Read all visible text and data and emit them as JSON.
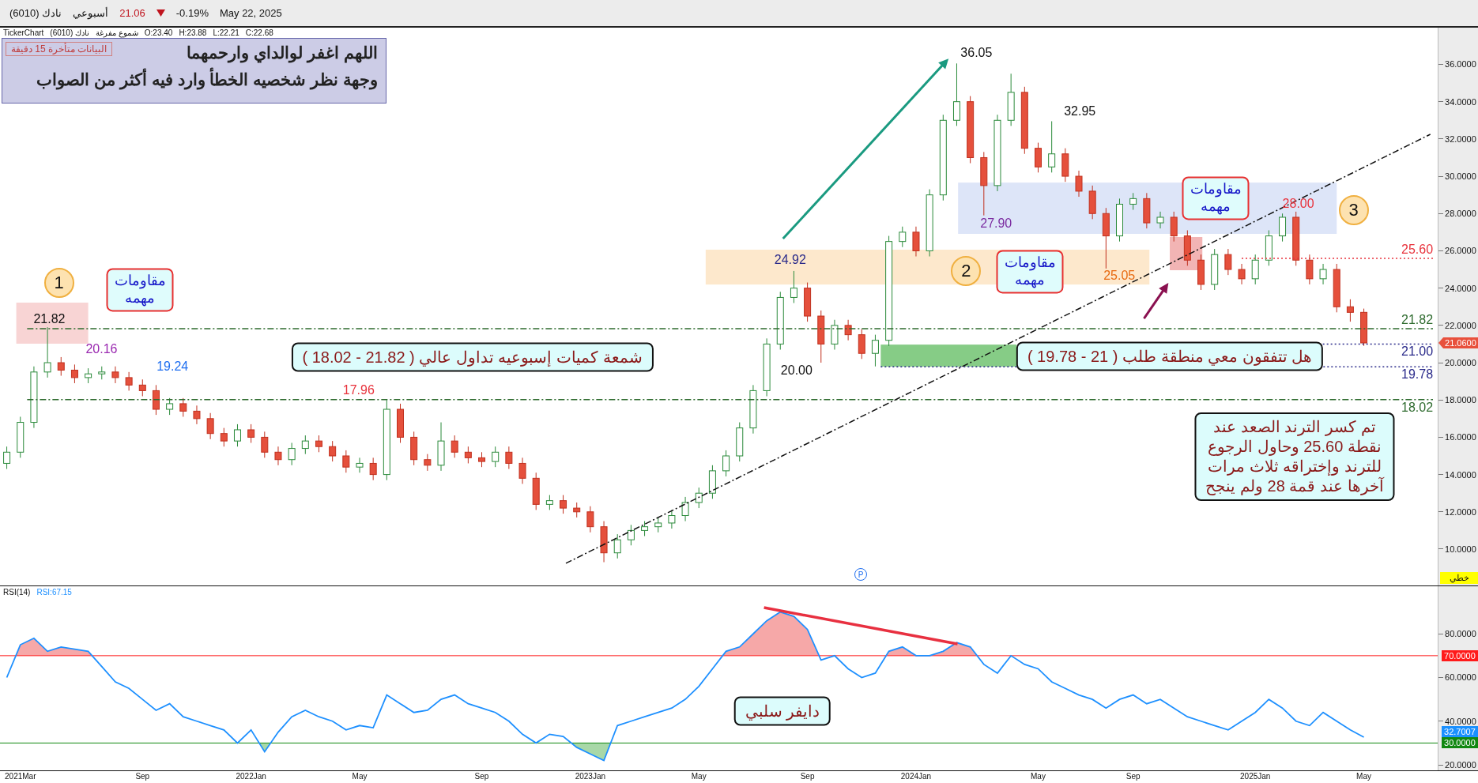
{
  "header": {
    "symbol": "نادك (6010)",
    "interval": "أسبوعي",
    "price": "21.06",
    "down": true,
    "change": "-0.19%",
    "date": "May 22, 2025"
  },
  "legend": {
    "source": "TickerChart",
    "symbol": "نادك (6010)",
    "chart_style": "شموع مفرغة",
    "ohlc": [
      "O:23.40",
      "H:23.88",
      "L:22.21",
      "C:22.68"
    ]
  },
  "info_box": {
    "delay_badge": "البيانات متأخرة 15 دقيقة",
    "lines": [
      "اللهم اغفر لوالداي وارحمهما",
      "وجهة نظر شخصيه الخطأ وارد فيه أكثر من الصواب"
    ]
  },
  "price_chart": {
    "price_tag": "21.0600",
    "scale_mode": "خطي",
    "marker": "P",
    "chart_data": {
      "type": "candlestick",
      "ylim": [
        8.05,
        37.97
      ],
      "ref_lines": [
        {
          "axis": "y",
          "value": 25.6,
          "label": "25.60",
          "color": "#e8323c"
        },
        {
          "axis": "y",
          "value": 21.82,
          "label": "21.82",
          "color": "#2e6b2e"
        },
        {
          "axis": "y",
          "value": 21.0,
          "label": "21.00",
          "color": "#2a2a8a"
        },
        {
          "axis": "y",
          "value": 19.78,
          "label": "19.78",
          "color": "#2a2a8a"
        },
        {
          "axis": "y",
          "value": 18.02,
          "label": "18.02",
          "color": "#2e6b2e"
        }
      ],
      "yticks": [
        {
          "value": 10,
          "label": "10.0000"
        },
        {
          "value": 12,
          "label": "12.0000"
        },
        {
          "value": 14,
          "label": "14.0000"
        },
        {
          "value": 16,
          "label": "16.0000"
        },
        {
          "value": 18,
          "label": "18.0000"
        },
        {
          "value": 20,
          "label": "20.0000"
        },
        {
          "value": 22,
          "label": "22.0000"
        },
        {
          "value": 24,
          "label": "24.0000"
        },
        {
          "value": 26,
          "label": "26.0000"
        },
        {
          "value": 28,
          "label": "28.0000"
        },
        {
          "value": 30,
          "label": "30.0000"
        },
        {
          "value": 32,
          "label": "32.0000"
        },
        {
          "value": 34,
          "label": "34.0000"
        },
        {
          "value": 36,
          "label": "36.0000"
        }
      ],
      "categories": [
        null,
        null,
        null,
        null,
        null,
        null,
        null,
        null,
        null,
        null,
        null,
        null,
        null,
        null,
        null,
        null,
        null,
        null,
        null,
        null,
        null,
        null,
        null,
        null,
        null,
        null,
        null,
        null,
        null,
        null,
        null,
        null,
        null,
        null,
        null,
        null,
        null,
        null,
        null,
        null,
        null,
        null,
        null,
        null,
        null,
        null,
        null,
        null,
        null,
        null,
        null,
        null,
        null,
        null,
        null,
        null,
        null,
        null,
        null,
        null,
        null,
        null,
        null,
        null,
        null,
        null,
        null,
        null,
        null,
        null,
        null,
        null,
        null,
        null,
        null,
        null,
        null,
        null,
        null,
        null,
        null,
        null,
        null,
        null,
        null,
        null,
        null,
        null,
        null,
        null,
        null,
        null,
        null,
        null,
        null,
        null,
        null,
        null,
        null,
        null,
        null,
        null,
        null,
        null,
        null,
        null
      ],
      "ohlc": [
        [
          14.6,
          15.5,
          14.3,
          15.2
        ],
        [
          15.2,
          17.1,
          14.9,
          16.8
        ],
        [
          16.8,
          19.8,
          16.5,
          19.5
        ],
        [
          19.5,
          21.9,
          19.2,
          20.0
        ],
        [
          20.0,
          20.3,
          19.3,
          19.6
        ],
        [
          19.6,
          19.9,
          18.9,
          19.2
        ],
        [
          19.2,
          19.7,
          18.9,
          19.4
        ],
        [
          19.4,
          19.8,
          19.1,
          19.5
        ],
        [
          19.5,
          19.8,
          18.9,
          19.2
        ],
        [
          19.2,
          19.5,
          18.5,
          18.8
        ],
        [
          18.8,
          19.1,
          18.2,
          18.5
        ],
        [
          18.5,
          18.8,
          17.2,
          17.5
        ],
        [
          17.5,
          18.1,
          17.2,
          17.8
        ],
        [
          17.8,
          18.1,
          17.1,
          17.4
        ],
        [
          17.4,
          17.7,
          16.7,
          17.0
        ],
        [
          17.0,
          17.3,
          15.9,
          16.2
        ],
        [
          16.2,
          16.5,
          15.5,
          15.8
        ],
        [
          15.8,
          16.7,
          15.5,
          16.4
        ],
        [
          16.4,
          16.7,
          15.7,
          16.0
        ],
        [
          16.0,
          16.3,
          14.9,
          15.2
        ],
        [
          15.2,
          15.5,
          14.5,
          14.8
        ],
        [
          14.8,
          15.7,
          14.5,
          15.4
        ],
        [
          15.4,
          16.1,
          15.1,
          15.8
        ],
        [
          15.8,
          16.1,
          15.2,
          15.5
        ],
        [
          15.5,
          15.8,
          14.7,
          15.0
        ],
        [
          15.0,
          15.3,
          14.1,
          14.4
        ],
        [
          14.4,
          14.9,
          14.1,
          14.6
        ],
        [
          14.6,
          14.9,
          13.7,
          14.0
        ],
        [
          14.0,
          18.0,
          13.7,
          17.5
        ],
        [
          17.5,
          17.8,
          15.7,
          16.0
        ],
        [
          16.0,
          16.3,
          14.5,
          14.8
        ],
        [
          14.8,
          15.1,
          14.2,
          14.5
        ],
        [
          14.5,
          16.8,
          14.2,
          15.8
        ],
        [
          15.8,
          16.1,
          14.9,
          15.2
        ],
        [
          15.2,
          15.5,
          14.6,
          14.9
        ],
        [
          14.9,
          15.2,
          14.4,
          14.7
        ],
        [
          14.7,
          15.5,
          14.4,
          15.2
        ],
        [
          15.2,
          15.5,
          14.3,
          14.6
        ],
        [
          14.6,
          14.9,
          13.5,
          13.8
        ],
        [
          13.8,
          14.1,
          12.1,
          12.4
        ],
        [
          12.4,
          12.9,
          12.1,
          12.6
        ],
        [
          12.6,
          12.9,
          11.9,
          12.2
        ],
        [
          12.2,
          12.5,
          11.7,
          12.0
        ],
        [
          12.0,
          12.3,
          10.9,
          11.2
        ],
        [
          11.2,
          11.5,
          9.3,
          9.8
        ],
        [
          9.8,
          10.8,
          9.5,
          10.5
        ],
        [
          10.5,
          11.3,
          10.2,
          11.0
        ],
        [
          11.0,
          11.5,
          10.7,
          11.2
        ],
        [
          11.2,
          11.7,
          10.9,
          11.4
        ],
        [
          11.4,
          12.1,
          11.1,
          11.8
        ],
        [
          11.8,
          12.8,
          11.5,
          12.5
        ],
        [
          12.5,
          13.3,
          12.2,
          13.0
        ],
        [
          13.0,
          14.5,
          12.7,
          14.2
        ],
        [
          14.2,
          15.3,
          13.9,
          15.0
        ],
        [
          15.0,
          16.8,
          14.7,
          16.5
        ],
        [
          16.5,
          18.8,
          16.2,
          18.5
        ],
        [
          18.5,
          21.3,
          18.2,
          21.0
        ],
        [
          21.0,
          23.8,
          20.7,
          23.5
        ],
        [
          23.5,
          24.92,
          23.2,
          24.0
        ],
        [
          24.0,
          24.3,
          22.2,
          22.5
        ],
        [
          22.5,
          22.8,
          20.0,
          21.0
        ],
        [
          21.0,
          22.3,
          20.7,
          22.0
        ],
        [
          22.0,
          22.3,
          21.2,
          21.5
        ],
        [
          21.5,
          21.8,
          20.2,
          20.5
        ],
        [
          20.5,
          21.5,
          19.8,
          21.2
        ],
        [
          21.2,
          26.8,
          20.9,
          26.5
        ],
        [
          26.5,
          27.3,
          26.2,
          27.0
        ],
        [
          27.0,
          27.3,
          25.7,
          26.0
        ],
        [
          26.0,
          29.3,
          25.7,
          29.0
        ],
        [
          29.0,
          33.3,
          28.7,
          33.0
        ],
        [
          33.0,
          36.05,
          32.7,
          34.0
        ],
        [
          34.0,
          34.3,
          30.7,
          31.0
        ],
        [
          31.0,
          31.3,
          27.9,
          29.5
        ],
        [
          29.5,
          33.3,
          29.2,
          33.0
        ],
        [
          33.0,
          35.5,
          32.7,
          34.5
        ],
        [
          34.5,
          34.8,
          31.2,
          31.5
        ],
        [
          31.5,
          31.8,
          30.2,
          30.5
        ],
        [
          30.5,
          32.95,
          30.2,
          31.2
        ],
        [
          31.2,
          31.5,
          29.7,
          30.0
        ],
        [
          30.0,
          30.3,
          28.9,
          29.2
        ],
        [
          29.2,
          29.5,
          27.7,
          28.0
        ],
        [
          28.0,
          28.3,
          25.05,
          26.8
        ],
        [
          26.8,
          28.8,
          26.5,
          28.5
        ],
        [
          28.5,
          29.1,
          28.2,
          28.8
        ],
        [
          28.8,
          29.1,
          27.2,
          27.5
        ],
        [
          27.5,
          28.1,
          27.2,
          27.8
        ],
        [
          27.8,
          28.1,
          26.5,
          26.8
        ],
        [
          26.8,
          27.1,
          25.2,
          25.5
        ],
        [
          25.5,
          25.8,
          23.9,
          24.2
        ],
        [
          24.2,
          26.1,
          23.9,
          25.8
        ],
        [
          25.8,
          26.1,
          24.7,
          25.0
        ],
        [
          25.0,
          25.3,
          24.2,
          24.5
        ],
        [
          24.5,
          25.8,
          24.2,
          25.5
        ],
        [
          25.5,
          27.1,
          25.2,
          26.8
        ],
        [
          26.8,
          28.0,
          26.5,
          27.8
        ],
        [
          27.8,
          28.1,
          25.2,
          25.5
        ],
        [
          25.5,
          25.8,
          24.2,
          24.5
        ],
        [
          24.5,
          25.3,
          24.2,
          25.0
        ],
        [
          25.0,
          25.3,
          22.7,
          23.0
        ],
        [
          23.0,
          23.4,
          22.2,
          22.7
        ],
        [
          22.7,
          22.9,
          20.9,
          21.06
        ],
        null,
        null,
        null,
        null,
        null
      ]
    },
    "zones": [
      {
        "color": "#f8d4d4"
      },
      {
        "color": "#fde8cc"
      },
      {
        "color": "#dde5f8"
      },
      {
        "color": "#f2b4b4"
      },
      {
        "color": "#86cc86"
      }
    ],
    "arrows": [
      {
        "color": "#1a9a80"
      },
      {
        "color": "#8a1050"
      }
    ],
    "labels": [
      {
        "text": "21.82",
        "color": "#111111"
      },
      {
        "text": "20.16",
        "color": "#9a28b0"
      },
      {
        "text": "19.24",
        "color": "#1e6ef0"
      },
      {
        "text": "17.96",
        "color": "#e8323c"
      },
      {
        "text": "36.05",
        "color": "#111111"
      },
      {
        "text": "32.95",
        "color": "#111111"
      },
      {
        "text": "24.92",
        "color": "#2a2a8a"
      },
      {
        "text": "20.00",
        "color": "#111111"
      },
      {
        "text": "27.90",
        "color": "#7a2aa0"
      },
      {
        "text": "25.05",
        "color": "#e86a10"
      },
      {
        "text": "28.00",
        "color": "#e8323c"
      }
    ],
    "badges": [
      "1",
      "2",
      "3"
    ],
    "resistance_notes": [
      {
        "lines": [
          "مقاومات",
          "مهمه"
        ]
      },
      {
        "lines": [
          "مقاومات",
          "مهمه"
        ]
      },
      {
        "lines": [
          "مقاومات",
          "مهمه"
        ]
      }
    ],
    "notes": [
      {
        "lines": [
          "هل تتفقون معي منطقة طلب ( 21 - 19.78 )"
        ]
      },
      {
        "lines": [
          "شمعة كميات إسبوعيه تداول عالي ( 21.82 - 18.02 )"
        ]
      },
      {
        "lines": [
          "تم كسر الترند الصعد عند",
          "نقطة 25.60  وحاول  الرجوع",
          "للترند وإختراقه ثلاث مرات",
          "آخرها عند قمة 28 ولم ينجح"
        ]
      }
    ]
  },
  "rsi_chart": {
    "title": "RSI(14)",
    "reading": "RSI:67.15",
    "note": "دايفر سلبي",
    "value_tag": "32.7007",
    "chart_data": {
      "type": "line",
      "ylim": [
        17.47,
        101.8
      ],
      "ref_lines": [
        {
          "axis": "y",
          "value": 70,
          "label": "70.0000",
          "color": "#ff1a1a"
        },
        {
          "axis": "y",
          "value": 30,
          "label": "30.0000",
          "color": "#118811"
        }
      ],
      "categories": [
        null,
        "2021Mar",
        null,
        null,
        null,
        null,
        null,
        null,
        null,
        null,
        "Sep",
        null,
        null,
        null,
        null,
        null,
        null,
        null,
        "2022Jan",
        null,
        null,
        null,
        null,
        null,
        null,
        null,
        "May",
        null,
        null,
        null,
        null,
        null,
        null,
        null,
        null,
        "Sep",
        null,
        null,
        null,
        null,
        null,
        null,
        null,
        "2023Jan",
        null,
        null,
        null,
        null,
        null,
        null,
        null,
        "May",
        null,
        null,
        null,
        null,
        null,
        null,
        null,
        "Sep",
        null,
        null,
        null,
        null,
        null,
        null,
        null,
        "2024Jan",
        null,
        null,
        null,
        null,
        null,
        null,
        null,
        null,
        "May",
        null,
        null,
        null,
        null,
        null,
        null,
        "Sep",
        null,
        null,
        null,
        null,
        null,
        null,
        null,
        null,
        "2025Jan",
        null,
        null,
        null,
        null,
        null,
        null,
        null,
        "May",
        null,
        null,
        null,
        null,
        null
      ],
      "yticks": [
        {
          "value": 20,
          "label": "20.0000"
        },
        {
          "value": 40,
          "label": "40.0000"
        },
        {
          "value": 60,
          "label": "60.0000"
        },
        {
          "value": 80,
          "label": "80.0000"
        }
      ],
      "series": [
        {
          "color": "#1e90ff",
          "values": [
            60,
            75,
            78,
            72,
            74,
            73,
            72,
            65,
            58,
            55,
            50,
            45,
            48,
            42,
            40,
            38,
            36,
            30,
            36,
            26,
            35,
            42,
            45,
            42,
            40,
            36,
            38,
            37,
            52,
            48,
            44,
            45,
            50,
            52,
            48,
            46,
            44,
            40,
            34,
            30,
            34,
            33,
            28,
            25,
            22,
            38,
            40,
            42,
            44,
            46,
            50,
            56,
            64,
            72,
            74,
            80,
            86,
            90,
            88,
            82,
            68,
            70,
            64,
            60,
            62,
            72,
            74,
            70,
            70,
            72,
            76,
            74,
            66,
            62,
            70,
            66,
            64,
            58,
            55,
            52,
            50,
            46,
            50,
            52,
            48,
            50,
            46,
            42,
            40,
            38,
            36,
            40,
            44,
            50,
            46,
            40,
            38,
            44,
            40,
            36,
            32.7,
            null,
            null,
            null,
            null,
            null
          ]
        }
      ]
    }
  }
}
